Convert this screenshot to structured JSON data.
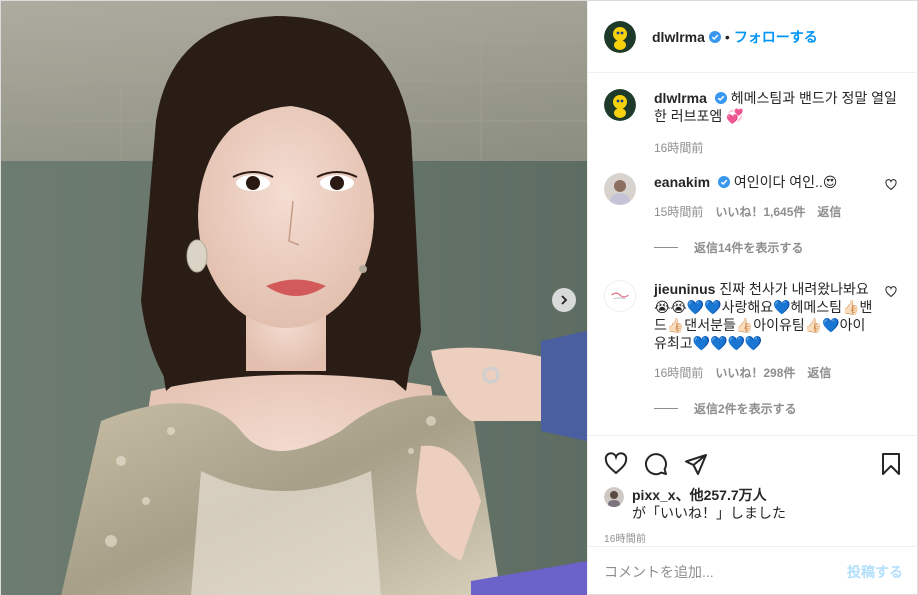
{
  "post": {
    "username": "dlwlrma",
    "follow_label": "フォローする",
    "dot": "•",
    "photo_alt": "dlwlrma photo",
    "image_next_icon": "chevron-right-icon"
  },
  "caption": {
    "username": "dlwlrma",
    "text": "헤메스팀과 밴드가 정말 열일한 러브포엠 💞",
    "time": "16時間前"
  },
  "comments": [
    {
      "username": "eanakim",
      "text": "여인이다 여인..😍",
      "time": "15時間前",
      "likes": "いいね！1,645件",
      "reply": "返信",
      "replies_label": "返信14件を表示する"
    },
    {
      "username": "jieuninus",
      "text": "진짜 천사가 내려왔나봐요😭😭💙💙사랑해요💙헤메스팀👍🏻밴드👍🏻댄서분들👍🏻아이유팀👍🏻💙아이유최고💙💙💙💙",
      "time": "16時間前",
      "likes": "いいね！298件",
      "reply": "返信",
      "replies_label": "返信2件を表示する"
    }
  ],
  "likes": {
    "names": "pixx_x、他257.7万人",
    "suffix": "が「いいね！」しました"
  },
  "posted_time": "16時間前",
  "comment_box": {
    "placeholder": "コメントを追加...",
    "post_label": "投稿する"
  },
  "colors": {
    "accent": "#0095f6",
    "verified": "#3897f0",
    "muted": "#8e8e8e",
    "post_disabled": "#b2dffc"
  }
}
